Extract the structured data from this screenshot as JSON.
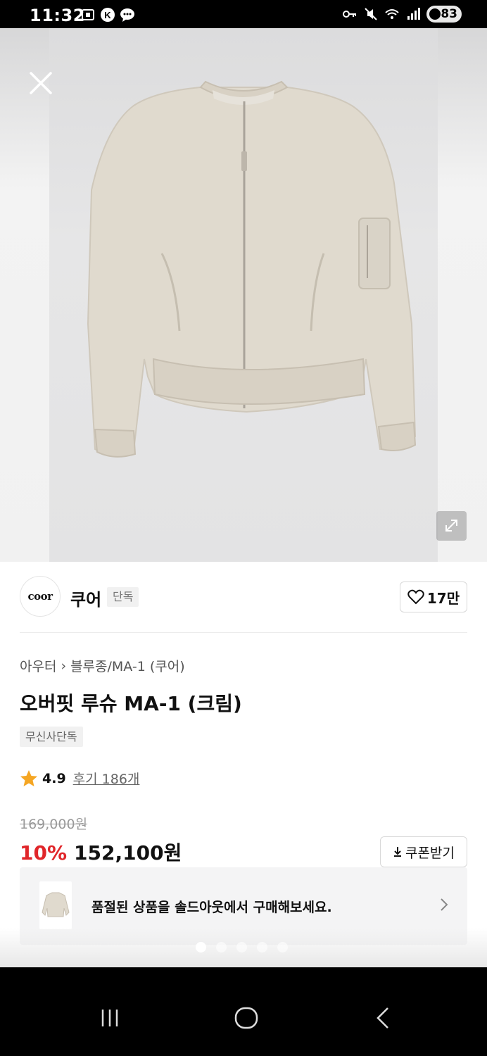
{
  "status_bar": {
    "time": "11:32",
    "battery": "83",
    "icons": [
      "screenshot-icon",
      "k-app-icon",
      "message-icon",
      "key-icon",
      "mute-icon",
      "wifi-icon",
      "signal-icon",
      "battery-icon"
    ]
  },
  "hero": {
    "image": "cream-bomber-jacket-photo",
    "carousel_count": 5,
    "active_index": 0
  },
  "brand": {
    "logo_text": "coor",
    "name": "쿠어",
    "badge": "단독",
    "likes": "17만"
  },
  "breadcrumb": {
    "category": "아우터",
    "separator": "›",
    "subcategory": "블루종/MA-1 (쿠어)"
  },
  "product": {
    "title": "오버핏 루슈 MA-1 (크림)",
    "tag": "무신사단독",
    "rating": "4.9",
    "reviews": "후기 186개",
    "original_price": "169,000원",
    "discount": "10%",
    "price": "152,100원",
    "coupon_label": "쿠폰받기"
  },
  "soldout": {
    "text": "품절된 상품을 솔드아웃에서 구매해보세요."
  },
  "colors": {
    "discount": "#e0262a",
    "star": "#f5a623"
  }
}
